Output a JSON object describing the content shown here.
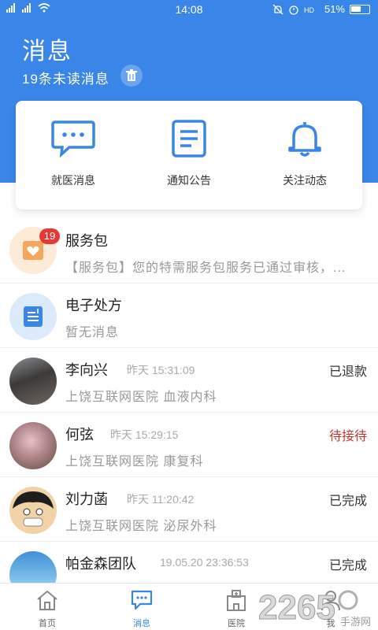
{
  "status_bar": {
    "left": "4G 2G",
    "time": "14:08",
    "battery": "51%",
    "colors": {
      "text": "#ffffff"
    }
  },
  "header": {
    "title": "消息",
    "unread": "19条未读消息",
    "bg_color": "#3a86e8"
  },
  "categories": [
    {
      "label": "就医消息",
      "icon": "chat-bubble-icon"
    },
    {
      "label": "通知公告",
      "icon": "document-icon"
    },
    {
      "label": "关注动态",
      "icon": "bell-icon"
    }
  ],
  "messages": [
    {
      "name": "服务包",
      "time": "",
      "status": "",
      "sub": "【服务包】您的特需服务包服务已通过审核，...",
      "badge": "19",
      "avatar": "service-package-icon"
    },
    {
      "name": "电子处方",
      "time": "",
      "status": "",
      "sub": "暂无消息",
      "badge": "",
      "avatar": "prescription-icon"
    },
    {
      "name": "李向兴",
      "time": "昨天  15:31:09",
      "status": "已退款",
      "sub": "上饶互联网医院   血液内科",
      "badge": "",
      "avatar": "user-photo"
    },
    {
      "name": "何弦",
      "time": "昨天  15:29:15",
      "status": "待接待",
      "sub": "上饶互联网医院   康复科",
      "badge": "",
      "avatar": "user-photo"
    },
    {
      "name": "刘力菡",
      "time": "昨天  11:20:42",
      "status": "已完成",
      "sub": "上饶互联网医院   泌尿外科",
      "badge": "",
      "avatar": "user-photo"
    },
    {
      "name": "帕金森团队",
      "time": "19.05.20  23:36:53",
      "status": "已完成",
      "sub": "",
      "badge": "",
      "avatar": "team-photo"
    }
  ],
  "bottom_nav": [
    {
      "label": "首页",
      "icon": "home-icon",
      "active": false
    },
    {
      "label": "消息",
      "icon": "message-icon",
      "active": true
    },
    {
      "label": "医院",
      "icon": "hospital-icon",
      "active": false
    },
    {
      "label": "我",
      "icon": "profile-icon",
      "active": false
    }
  ],
  "watermark": {
    "text": "2265",
    "sub": "手游网"
  },
  "colors": {
    "accent": "#3a86e8",
    "badge": "#e53935",
    "pending": "#c0392b"
  }
}
